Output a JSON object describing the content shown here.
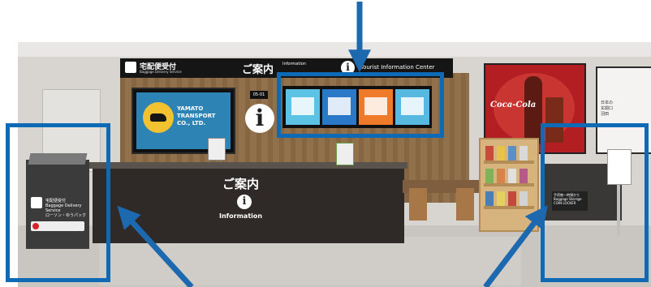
{
  "scene": {
    "header_sign": {
      "baggage_label": "宅配便受付",
      "baggage_sub": "Baggage Delivery Service",
      "guide_label": "ご案内",
      "guide_en": "Information",
      "tourist_label": "Tourist Information Center"
    },
    "yamato_screen": {
      "text": "YAMATO\nTRANSPORT\nCO., LTD."
    },
    "counter_number": "05-01",
    "main_counter": {
      "title": "ご案内",
      "subtitle": "Information"
    },
    "left_counter": {
      "label": "宅配便受付\nBaggage Delivery Service\nローソン・ゆうパック"
    },
    "right_counter": {
      "label": "手荷物一時預かり\nBaggage Storage\nCOIN LOCKER"
    },
    "promo_panel": {
      "brand": "Coca-Cola"
    },
    "right_panel": {
      "label": "日本の\n玄関口\n羽田"
    }
  },
  "highlights": [
    {
      "id": "left-counter"
    },
    {
      "id": "digital-screens"
    },
    {
      "id": "right-counter"
    }
  ],
  "colors": {
    "highlight": "#0e6ab5",
    "arrow": "#1c69b0"
  }
}
